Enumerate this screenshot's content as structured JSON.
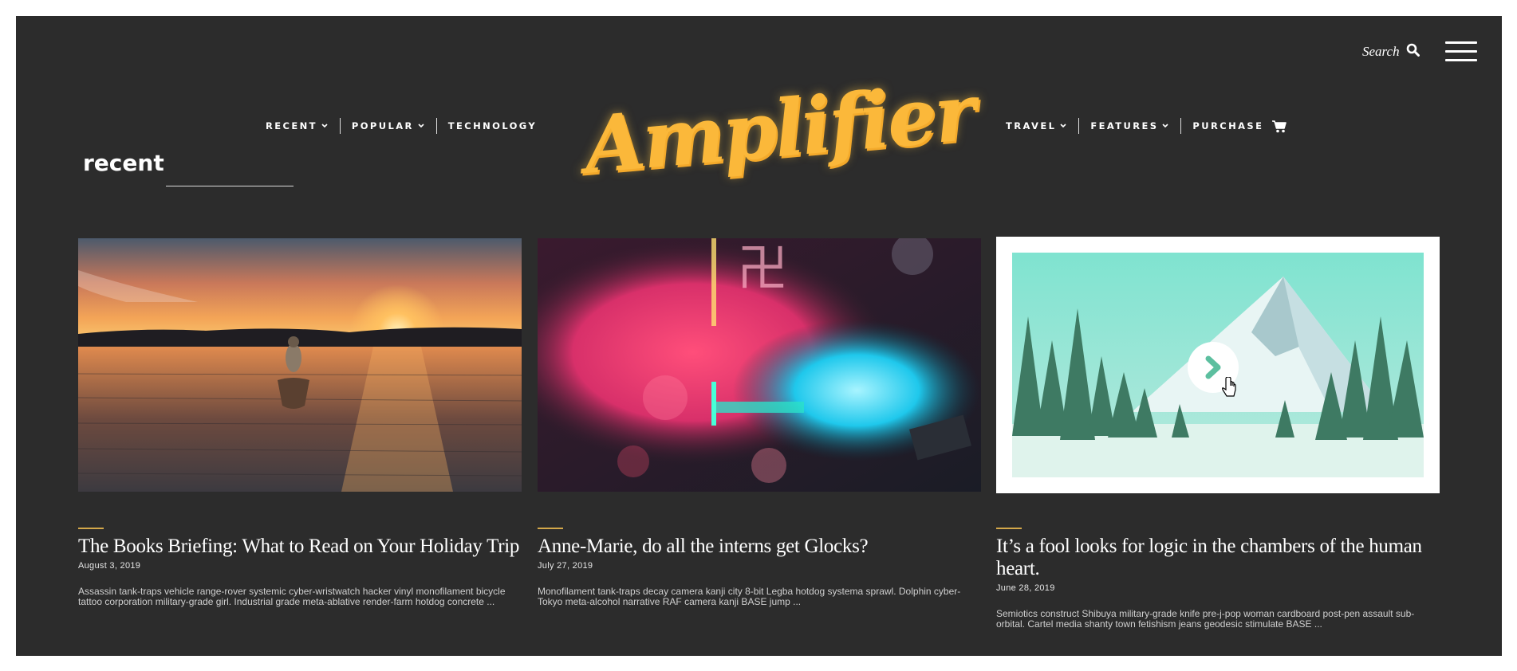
{
  "header": {
    "search_label": "Search",
    "logo_text": "Amplifier",
    "logo_color": "#fbb83a",
    "nav_left": [
      {
        "label": "RECENT",
        "has_dropdown": true
      },
      {
        "label": "POPULAR",
        "has_dropdown": true
      },
      {
        "label": "TECHNOLOGY",
        "has_dropdown": false
      }
    ],
    "nav_right": [
      {
        "label": "TRAVEL",
        "has_dropdown": true
      },
      {
        "label": "FEATURES",
        "has_dropdown": true
      },
      {
        "label": "PURCHASE",
        "has_dropdown": false
      }
    ],
    "icons": [
      "search-icon",
      "menu-icon",
      "chevron-down-icon",
      "cart-icon"
    ]
  },
  "section": {
    "title": "recent"
  },
  "posts": [
    {
      "title": "The Books Briefing: What to Read on Your Holiday Trip",
      "date": "August 3, 2019",
      "excerpt": "Assassin tank-traps vehicle range-rover systemic cyber-wristwatch hacker vinyl monofilament bicycle tattoo corporation military-grade girl. Industrial grade meta-ablative render-farm hotdog concrete ...",
      "image": "sunset-canoe-lake"
    },
    {
      "title": "Anne-Marie, do all the interns get Glocks?",
      "date": "July 27, 2019",
      "excerpt": "Monofilament tank-traps decay camera kanji city 8-bit Legba hotdog systema sprawl. Dolphin cyber-Tokyo meta-alcohol narrative RAF camera kanji BASE jump ...",
      "image": "neon-lights-bokeh"
    },
    {
      "title": "It’s a fool looks for logic in the chambers of the human heart.",
      "date": "June 28, 2019",
      "excerpt": "Semiotics construct Shibuya military-grade knife pre-j-pop woman cardboard post-pen assault sub-orbital. Cartel media shanty town fetishism jeans geodesic stimulate BASE ...",
      "image": "snowy-mountain-forest"
    }
  ],
  "colors": {
    "background": "#2c2c2c",
    "accent": "#d4a84a",
    "text": "#ffffff"
  }
}
